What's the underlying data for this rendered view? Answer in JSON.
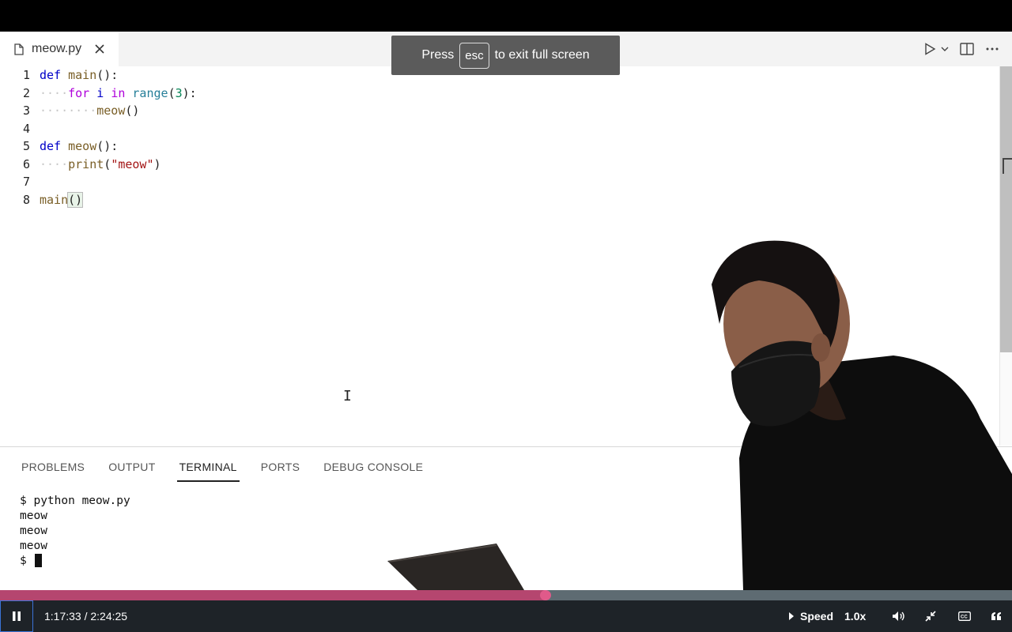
{
  "tab": {
    "filename": "meow.py"
  },
  "fullscreen_toast": {
    "press": "Press",
    "key": "esc",
    "suffix": "to exit full screen"
  },
  "code": {
    "line_numbers": [
      "1",
      "2",
      "3",
      "4",
      "5",
      "6",
      "7",
      "8"
    ]
  },
  "panel": {
    "tabs": [
      "PROBLEMS",
      "OUTPUT",
      "TERMINAL",
      "PORTS",
      "DEBUG CONSOLE"
    ],
    "active_tab": "TERMINAL"
  },
  "terminal": {
    "lines": [
      "$ python meow.py",
      "meow",
      "meow",
      "meow"
    ],
    "prompt": "$"
  },
  "player": {
    "time": "1:17:33 / 2:24:25",
    "progress": 0.539,
    "speed_label": "Speed",
    "speed_value": "1.0x"
  },
  "colors": {
    "progress_fill": "#b5466f",
    "progress_track": "#5e6b72",
    "controls_bg": "#1e2328"
  }
}
